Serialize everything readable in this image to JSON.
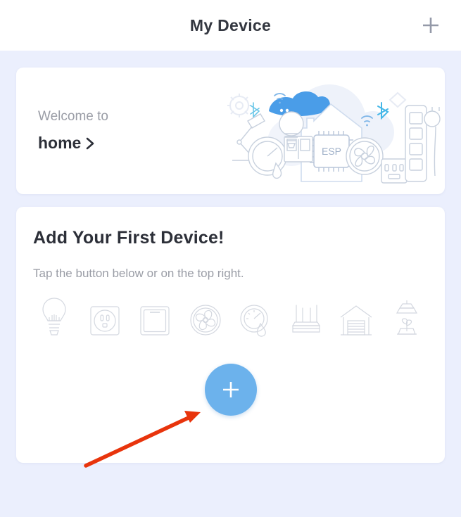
{
  "header": {
    "title": "My Device",
    "add_icon": "plus-icon"
  },
  "welcome_card": {
    "label": "Welcome to",
    "home_name": "home",
    "chevron_icon": "chevron-right-icon",
    "illustration": "smart-home-esp-illustration"
  },
  "add_device_card": {
    "title": "Add Your First Device!",
    "subtitle": "Tap the button below or on the top right.",
    "device_icons": [
      {
        "name": "light-bulb-icon"
      },
      {
        "name": "power-outlet-icon"
      },
      {
        "name": "wall-switch-icon"
      },
      {
        "name": "fan-icon"
      },
      {
        "name": "humidity-sensor-icon"
      },
      {
        "name": "router-icon"
      },
      {
        "name": "garage-door-icon"
      },
      {
        "name": "grow-light-plant-icon"
      }
    ],
    "fab_icon": "plus-icon"
  },
  "annotation": {
    "arrow_icon": "red-arrow-pointer",
    "arrow_color": "#e8340c"
  },
  "colors": {
    "page_background": "#ebeffd",
    "card_background": "#ffffff",
    "accent_blue": "#6cb2ec",
    "title_text": "#2c2f38",
    "muted_text": "#9a9da6",
    "icon_outline": "#d4d8e0",
    "annotation_red": "#e8340c"
  }
}
